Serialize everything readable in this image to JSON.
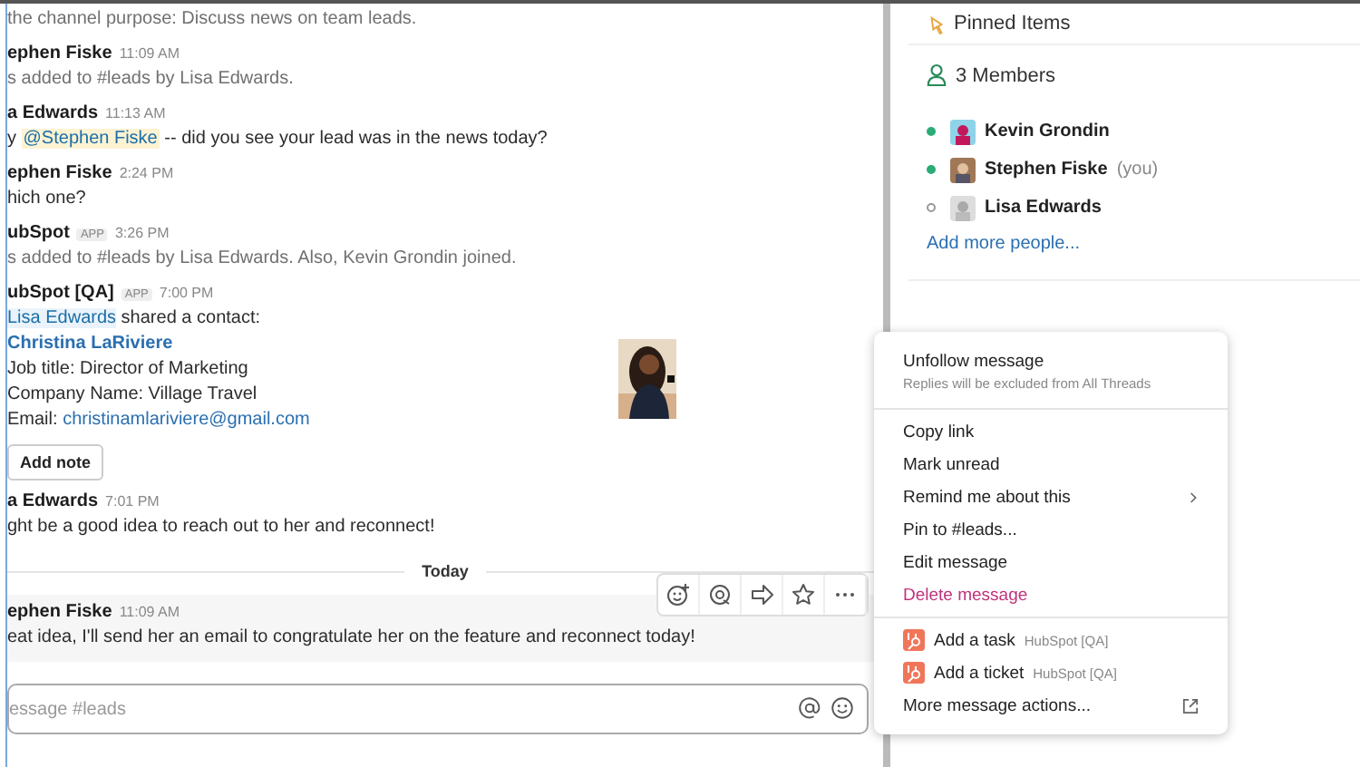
{
  "messages": [
    {
      "lines": [
        {
          "muted": true,
          "spans": [
            {
              "kind": "plain",
              "text": "the channel purpose: Discuss news on team leads."
            }
          ]
        }
      ]
    },
    {
      "author": "ephen Fiske",
      "time": "11:09 AM",
      "lines": [
        {
          "muted": true,
          "spans": [
            {
              "kind": "plain",
              "text": "s added to #leads by Lisa Edwards."
            }
          ]
        }
      ]
    },
    {
      "author": "a Edwards",
      "time": "11:13 AM",
      "lines": [
        {
          "muted": false,
          "spans": [
            {
              "kind": "plain",
              "text": "y "
            },
            {
              "kind": "mention",
              "text": "@Stephen Fiske"
            },
            {
              "kind": "plain",
              "text": " -- did you see your lead was in the news today?"
            }
          ]
        }
      ]
    },
    {
      "author": "ephen Fiske",
      "time": "2:24 PM",
      "lines": [
        {
          "muted": false,
          "spans": [
            {
              "kind": "plain",
              "text": "hich one?"
            }
          ]
        }
      ]
    },
    {
      "author": "ubSpot",
      "badge": "APP",
      "time": "3:26 PM",
      "lines": [
        {
          "muted": true,
          "spans": [
            {
              "kind": "plain",
              "text": "s added to #leads by Lisa Edwards. Also, Kevin Grondin joined."
            }
          ]
        }
      ]
    },
    {
      "author": "ubSpot [QA]",
      "badge": "APP",
      "time": "7:00 PM",
      "lines": [
        {
          "muted": false,
          "spans": [
            {
              "kind": "mention-link",
              "text": "Lisa Edwards"
            },
            {
              "kind": "plain",
              "text": " shared a contact:"
            }
          ]
        }
      ],
      "contact": {
        "name": "Christina LaRiviere",
        "fields": [
          "Job title: Director of Marketing",
          "Company Name: Village Travel"
        ],
        "email_label": "Email: ",
        "email": "christinamlariviere@gmail.com",
        "button": "Add note"
      }
    },
    {
      "author": "a Edwards",
      "time": "7:01 PM",
      "lines": [
        {
          "muted": false,
          "spans": [
            {
              "kind": "plain",
              "text": "ght be a good idea to reach out to her and reconnect!"
            }
          ]
        }
      ]
    }
  ],
  "divider": "Today",
  "hovered_message": {
    "author": "ephen Fiske",
    "time": "11:09 AM",
    "text": "eat idea, I'll send her an email to congratulate her on the feature and reconnect today!"
  },
  "composer": {
    "placeholder": "essage #leads"
  },
  "sidebar": {
    "pinned": "Pinned Items",
    "members_title": "3 Members",
    "members": [
      {
        "name": "Kevin Grondin",
        "online": true
      },
      {
        "name": "Stephen Fiske",
        "online": true,
        "suffix": "(you)"
      },
      {
        "name": "Lisa Edwards",
        "online": false
      }
    ],
    "add_people": "Add more people..."
  },
  "menu": {
    "sections": [
      [
        {
          "kind": "described",
          "label": "Unfollow message",
          "description": "Replies will be excluded from All Threads"
        }
      ],
      [
        {
          "kind": "normal",
          "label": "Copy link"
        },
        {
          "kind": "normal",
          "label": "Mark unread"
        },
        {
          "kind": "submenu",
          "label": "Remind me about this"
        },
        {
          "kind": "normal",
          "label": "Pin to #leads..."
        },
        {
          "kind": "normal",
          "label": "Edit message"
        },
        {
          "kind": "danger",
          "label": "Delete message"
        }
      ],
      [
        {
          "kind": "app",
          "label": "Add a task",
          "app": "HubSpot [QA]"
        },
        {
          "kind": "app",
          "label": "Add a ticket",
          "app": "HubSpot [QA]"
        },
        {
          "kind": "external",
          "label": "More message actions..."
        }
      ]
    ]
  }
}
